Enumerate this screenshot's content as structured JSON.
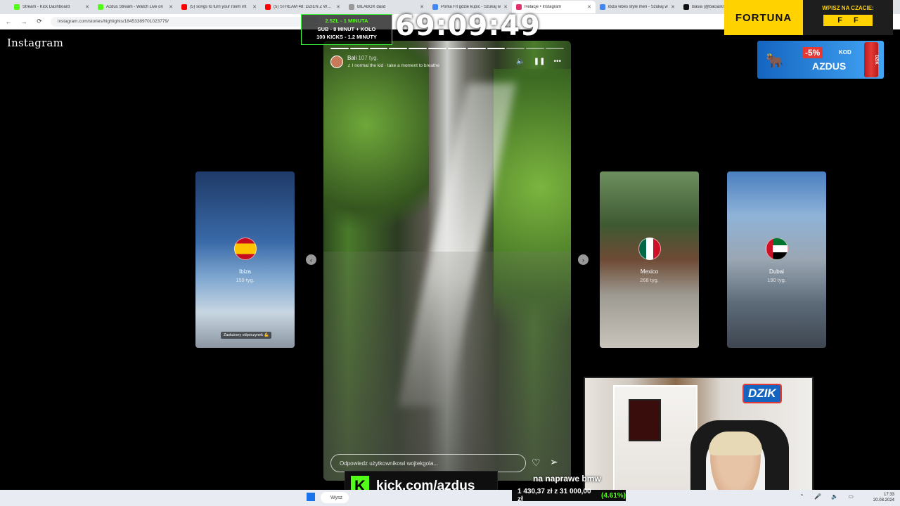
{
  "browser": {
    "tabs": [
      {
        "label": "Stream - Kick Dashboard",
        "color": "#53fc18"
      },
      {
        "label": "Azdus Stream - Watch Live on",
        "color": "#53fc18"
      },
      {
        "label": "(5) songs to turn your room int",
        "color": "#ff0000"
      },
      {
        "label": "(5) STREAM 48: DZIEŃ Z WAKI",
        "color": "#ff0000"
      },
      {
        "label": "BILABOX dasd",
        "color": "#999999"
      },
      {
        "label": "Porka Fit gdzie kupić - Szukaj w",
        "color": "#4285f4"
      },
      {
        "label": "Relacje • Instagram",
        "color": "#e1306c"
      },
      {
        "label": "ibiza vibes style men - Szukaj w",
        "color": "#4285f4"
      },
      {
        "label": "Basia (@bacias0",
        "color": "#111111"
      }
    ],
    "close_glyph": "✕",
    "url": "instagram.com/stories/highlights/18453389701023779/"
  },
  "instagram": {
    "logo": "Instagram",
    "main_story": {
      "user": "Bali",
      "age": "107 tyg.",
      "track": "♫ I normal the kid · take a moment to breathe",
      "reply_placeholder": "Odpowiedz użytkownikowi wojtekgola...",
      "progress_segments": 12,
      "progress_done": 9
    },
    "side_stories": [
      {
        "name": "Ibiza",
        "age": "159 tyg.",
        "caption": "Zasłużony odpoczynek 💪"
      },
      {
        "name": "Mexico",
        "age": "268 tyg."
      },
      {
        "name": "Dubai",
        "age": "190 tyg."
      }
    ]
  },
  "overlay": {
    "green_box": [
      "2.5ZŁ - 1 MINUTA",
      "SUB - 8 MINUT + KOŁO",
      "100 KICKS - 1.2 MINUTY"
    ],
    "timer": "69:09:49",
    "fortuna": {
      "logo": "FORTUNA",
      "cta": "WPISZ NA CZACIE:",
      "code_a": "F",
      "code_b": "F"
    },
    "dzik": {
      "discount": "-5%",
      "kod_label": "KOD",
      "code": "AZDUS",
      "can": "DZIK",
      "logo": "DZIK"
    },
    "kick": {
      "letter": "K",
      "url": "kick.com/azdus"
    },
    "goal": {
      "title": "na naprawe bmw",
      "amount": "1 430,37 zł z 31 000,00 zł",
      "percent": "(4.61%)"
    }
  },
  "taskbar": {
    "search": "Wysz",
    "time": "17:33",
    "date": "20.08.2024"
  }
}
